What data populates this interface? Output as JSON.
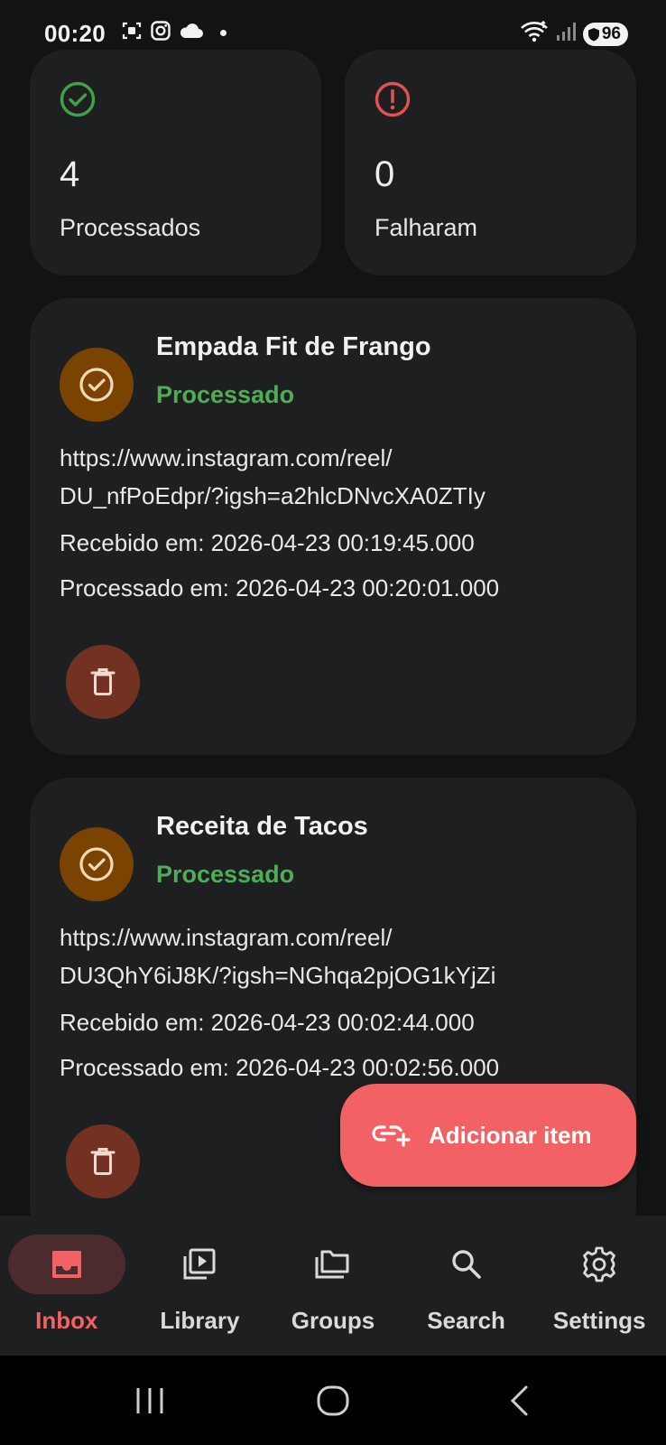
{
  "status_bar": {
    "time": "00:20",
    "left_icons": [
      "screenshot-icon",
      "instagram-icon",
      "cloud-icon",
      "notification-dot"
    ],
    "right_icons": [
      "wifi-icon",
      "signal-icon"
    ],
    "battery": "96"
  },
  "stats": {
    "processed": {
      "count": "4",
      "label": "Processados",
      "icon": "check-circle-icon",
      "color": "#43a047"
    },
    "failed": {
      "count": "0",
      "label": "Falharam",
      "icon": "error-circle-icon",
      "color": "#e05151"
    }
  },
  "items": [
    {
      "title": "Empada Fit de Frango",
      "status": "Processado",
      "url_line1": "https://www.instagram.com/reel/",
      "url_line2": "DU_nfPoEdpr/?igsh=a2hlcDNvcXA0ZTIy",
      "received": "Recebido em: 2026-04-23 00:19:45.000",
      "processed": "Processado em: 2026-04-23 00:20:01.000"
    },
    {
      "title": "Receita de Tacos",
      "status": "Processado",
      "url_line1": "https://www.instagram.com/reel/",
      "url_line2": "DU3QhY6iJ8K/?igsh=NGhqa2pjOG1kYjZi",
      "received": "Recebido em: 2026-04-23 00:02:44.000",
      "processed": "Processado em: 2026-04-23 00:02:56.000"
    }
  ],
  "fab": {
    "label": "Adicionar item",
    "icon": "add-link-icon"
  },
  "bottom_nav": [
    {
      "label": "Inbox",
      "icon": "inbox-icon",
      "active": true
    },
    {
      "label": "Library",
      "icon": "video-library-icon",
      "active": false
    },
    {
      "label": "Groups",
      "icon": "folders-icon",
      "active": false
    },
    {
      "label": "Search",
      "icon": "search-icon",
      "active": false
    },
    {
      "label": "Settings",
      "icon": "gear-icon",
      "active": false
    }
  ],
  "colors": {
    "accent": "#f26264",
    "success": "#4fae55",
    "card": "#1e1f21",
    "background": "#121314"
  }
}
